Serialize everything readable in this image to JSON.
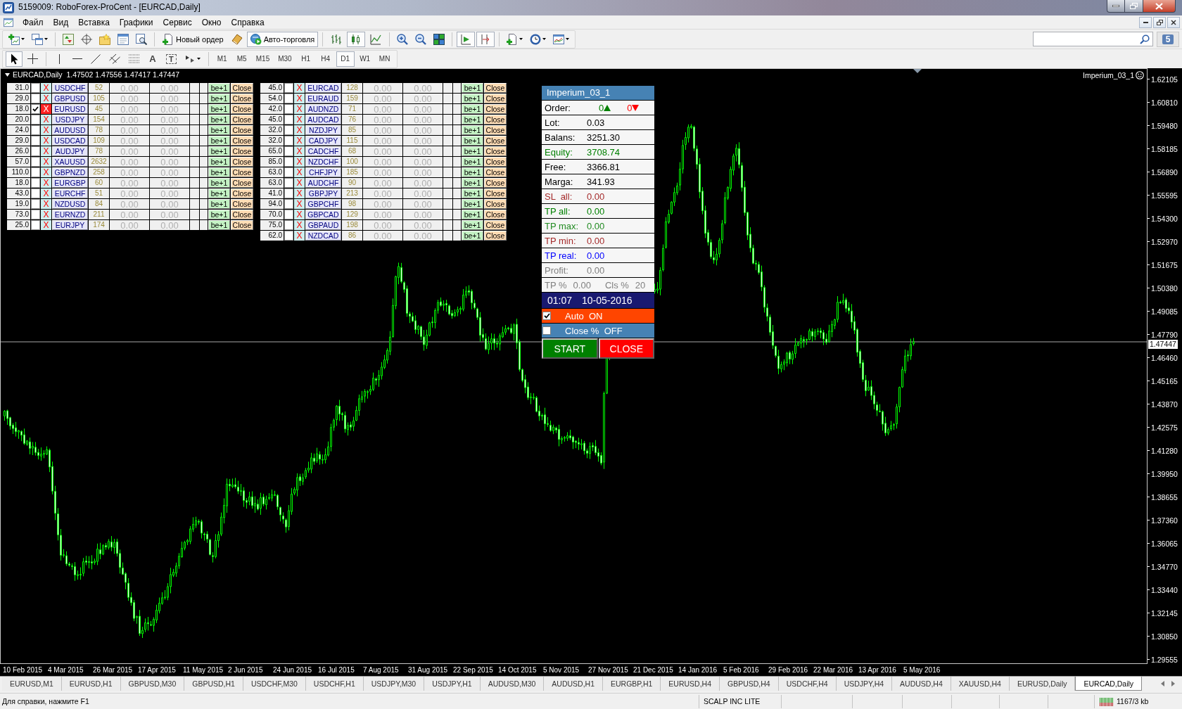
{
  "window": {
    "title": "5159009: RoboForex-ProCent - [EURCAD,Daily]"
  },
  "menu": [
    "Файл",
    "Вид",
    "Вставка",
    "Графики",
    "Сервис",
    "Окно",
    "Справка"
  ],
  "toolbar": {
    "new_order": "Новый ордер",
    "auto_trading": {
      "label": "Авто-торговля",
      "on": true
    },
    "chart_types": [
      {
        "kind": "bars",
        "selected": false
      },
      {
        "kind": "candles",
        "selected": true
      },
      {
        "kind": "line",
        "selected": false
      }
    ],
    "auto_scroll": {
      "on": true
    },
    "chart_shift": {
      "on": true
    },
    "messages_count": "5"
  },
  "drawing_tools": [
    {
      "kind": "cursor",
      "selected": true
    },
    {
      "kind": "crosshair",
      "selected": false
    },
    {
      "kind": "vertical_line",
      "selected": false
    },
    {
      "kind": "horizontal_line",
      "selected": false
    },
    {
      "kind": "trend_line",
      "selected": false
    },
    {
      "kind": "channel",
      "selected": false
    },
    {
      "kind": "fibonacci",
      "selected": false
    },
    {
      "kind": "text",
      "label": "A",
      "selected": false
    },
    {
      "kind": "text_label",
      "label": "T",
      "selected": false
    },
    {
      "kind": "arrows",
      "selected": false
    }
  ],
  "timeframes": [
    {
      "label": "M1",
      "selected": false
    },
    {
      "label": "M5",
      "selected": false
    },
    {
      "label": "M15",
      "selected": false
    },
    {
      "label": "M30",
      "selected": false
    },
    {
      "label": "H1",
      "selected": false
    },
    {
      "label": "H4",
      "selected": false
    },
    {
      "label": "D1",
      "selected": true
    },
    {
      "label": "W1",
      "selected": false
    },
    {
      "label": "MN",
      "selected": false
    }
  ],
  "chart": {
    "header": {
      "symbol": "EURCAD,Daily",
      "prices": [
        "1.47502",
        "1.47556",
        "1.47417",
        "1.47447"
      ]
    },
    "expert": "Imperium_03_1",
    "price_labels": [
      "1.62105",
      "1.60810",
      "1.59480",
      "1.58185",
      "1.56890",
      "1.55595",
      "1.54300",
      "1.52970",
      "1.51675",
      "1.50380",
      "1.49085",
      "1.47790",
      "1.46460",
      "1.45165",
      "1.43870",
      "1.42575",
      "1.41280",
      "1.39950",
      "1.38655",
      "1.37360",
      "1.36065",
      "1.34770",
      "1.33440",
      "1.32145",
      "1.30850",
      "1.29555"
    ],
    "current_price": "1.47447",
    "date_labels": [
      "10 Feb 2015",
      "4 Mar 2015",
      "26 Mar 2015",
      "17 Apr 2015",
      "11 May 2015",
      "2 Jun 2015",
      "24 Jun 2015",
      "16 Jul 2015",
      "7 Aug 2015",
      "31 Aug 2015",
      "22 Sep 2015",
      "14 Oct 2015",
      "5 Nov 2015",
      "27 Nov 2015",
      "21 Dec 2015",
      "14 Jan 2016",
      "5 Feb 2016",
      "29 Feb 2016",
      "22 Mar 2016",
      "13 Apr 2016",
      "5 May 2016"
    ],
    "tables": [
      {
        "rows": [
          {
            "value": "31.0",
            "checked": false,
            "x": "X",
            "x_active": false,
            "symbol": "USDCHF",
            "number": "52",
            "amount_1": "0.00",
            "amount_2": "0.00",
            "be": "be+1",
            "close": "Close"
          },
          {
            "value": "29.0",
            "checked": false,
            "x": "X",
            "x_active": false,
            "symbol": "GBPUSD",
            "number": "105",
            "amount_1": "0.00",
            "amount_2": "0.00",
            "be": "be+1",
            "close": "Close"
          },
          {
            "value": "18.0",
            "checked": true,
            "x": "X",
            "x_active": true,
            "symbol": "EURUSD",
            "number": "45",
            "amount_1": "0.00",
            "amount_2": "0.00",
            "be": "be+1",
            "close": "Close"
          },
          {
            "value": "20.0",
            "checked": false,
            "x": "X",
            "x_active": false,
            "symbol": "USDJPY",
            "number": "154",
            "amount_1": "0.00",
            "amount_2": "0.00",
            "be": "be+1",
            "close": "Close"
          },
          {
            "value": "24.0",
            "checked": false,
            "x": "X",
            "x_active": false,
            "symbol": "AUDUSD",
            "number": "78",
            "amount_1": "0.00",
            "amount_2": "0.00",
            "be": "be+1",
            "close": "Close"
          },
          {
            "value": "29.0",
            "checked": false,
            "x": "X",
            "x_active": false,
            "symbol": "USDCAD",
            "number": "109",
            "amount_1": "0.00",
            "amount_2": "0.00",
            "be": "be+1",
            "close": "Close"
          },
          {
            "value": "26.0",
            "checked": false,
            "x": "X",
            "x_active": false,
            "symbol": "AUDJPY",
            "number": "78",
            "amount_1": "0.00",
            "amount_2": "0.00",
            "be": "be+1",
            "close": "Close"
          },
          {
            "value": "57.0",
            "checked": false,
            "x": "X",
            "x_active": false,
            "symbol": "XAUUSD",
            "number": "2632",
            "amount_1": "0.00",
            "amount_2": "0.00",
            "be": "be+1",
            "close": "Close"
          },
          {
            "value": "110.0",
            "checked": false,
            "x": "X",
            "x_active": false,
            "symbol": "GBPNZD",
            "number": "258",
            "amount_1": "0.00",
            "amount_2": "0.00",
            "be": "be+1",
            "close": "Close"
          },
          {
            "value": "18.0",
            "checked": false,
            "x": "X",
            "x_active": false,
            "symbol": "EURGBP",
            "number": "60",
            "amount_1": "0.00",
            "amount_2": "0.00",
            "be": "be+1",
            "close": "Close"
          },
          {
            "value": "43.0",
            "checked": false,
            "x": "X",
            "x_active": false,
            "symbol": "EURCHF",
            "number": "51",
            "amount_1": "0.00",
            "amount_2": "0.00",
            "be": "be+1",
            "close": "Close"
          },
          {
            "value": "19.0",
            "checked": false,
            "x": "X",
            "x_active": false,
            "symbol": "NZDUSD",
            "number": "84",
            "amount_1": "0.00",
            "amount_2": "0.00",
            "be": "be+1",
            "close": "Close"
          },
          {
            "value": "73.0",
            "checked": false,
            "x": "X",
            "x_active": false,
            "symbol": "EURNZD",
            "number": "211",
            "amount_1": "0.00",
            "amount_2": "0.00",
            "be": "be+1",
            "close": "Close"
          },
          {
            "value": "25.0",
            "checked": false,
            "x": "X",
            "x_active": false,
            "symbol": "EURJPY",
            "number": "174",
            "amount_1": "0.00",
            "amount_2": "0.00",
            "be": "be+1",
            "close": "Close"
          }
        ]
      },
      {
        "rows": [
          {
            "value": "45.0",
            "checked": false,
            "x": "X",
            "x_active": false,
            "symbol": "EURCAD",
            "number": "128",
            "amount_1": "0.00",
            "amount_2": "0.00",
            "be": "be+1",
            "close": "Close"
          },
          {
            "value": "54.0",
            "checked": false,
            "x": "X",
            "x_active": false,
            "symbol": "EURAUD",
            "number": "159",
            "amount_1": "0.00",
            "amount_2": "0.00",
            "be": "be+1",
            "close": "Close"
          },
          {
            "value": "42.0",
            "checked": false,
            "x": "X",
            "x_active": false,
            "symbol": "AUDNZD",
            "number": "71",
            "amount_1": "0.00",
            "amount_2": "0.00",
            "be": "be+1",
            "close": "Close"
          },
          {
            "value": "45.0",
            "checked": false,
            "x": "X",
            "x_active": false,
            "symbol": "AUDCAD",
            "number": "76",
            "amount_1": "0.00",
            "amount_2": "0.00",
            "be": "be+1",
            "close": "Close"
          },
          {
            "value": "32.0",
            "checked": false,
            "x": "X",
            "x_active": false,
            "symbol": "NZDJPY",
            "number": "85",
            "amount_1": "0.00",
            "amount_2": "0.00",
            "be": "be+1",
            "close": "Close"
          },
          {
            "value": "32.0",
            "checked": false,
            "x": "X",
            "x_active": false,
            "symbol": "CADJPY",
            "number": "115",
            "amount_1": "0.00",
            "amount_2": "0.00",
            "be": "be+1",
            "close": "Close"
          },
          {
            "value": "65.0",
            "checked": false,
            "x": "X",
            "x_active": false,
            "symbol": "CADCHF",
            "number": "68",
            "amount_1": "0.00",
            "amount_2": "0.00",
            "be": "be+1",
            "close": "Close"
          },
          {
            "value": "85.0",
            "checked": false,
            "x": "X",
            "x_active": false,
            "symbol": "NZDCHF",
            "number": "100",
            "amount_1": "0.00",
            "amount_2": "0.00",
            "be": "be+1",
            "close": "Close"
          },
          {
            "value": "63.0",
            "checked": false,
            "x": "X",
            "x_active": false,
            "symbol": "CHFJPY",
            "number": "185",
            "amount_1": "0.00",
            "amount_2": "0.00",
            "be": "be+1",
            "close": "Close"
          },
          {
            "value": "63.0",
            "checked": false,
            "x": "X",
            "x_active": false,
            "symbol": "AUDCHF",
            "number": "90",
            "amount_1": "0.00",
            "amount_2": "0.00",
            "be": "be+1",
            "close": "Close"
          },
          {
            "value": "41.0",
            "checked": false,
            "x": "X",
            "x_active": false,
            "symbol": "GBPJPY",
            "number": "213",
            "amount_1": "0.00",
            "amount_2": "0.00",
            "be": "be+1",
            "close": "Close"
          },
          {
            "value": "94.0",
            "checked": false,
            "x": "X",
            "x_active": false,
            "symbol": "GBPCHF",
            "number": "98",
            "amount_1": "0.00",
            "amount_2": "0.00",
            "be": "be+1",
            "close": "Close"
          },
          {
            "value": "70.0",
            "checked": false,
            "x": "X",
            "x_active": false,
            "symbol": "GBPCAD",
            "number": "129",
            "amount_1": "0.00",
            "amount_2": "0.00",
            "be": "be+1",
            "close": "Close"
          },
          {
            "value": "75.0",
            "checked": false,
            "x": "X",
            "x_active": false,
            "symbol": "GBPAUD",
            "number": "198",
            "amount_1": "0.00",
            "amount_2": "0.00",
            "be": "be+1",
            "close": "Close"
          },
          {
            "value": "62.0",
            "checked": false,
            "x": "X",
            "x_active": false,
            "symbol": "NZDCAD",
            "number": "86",
            "amount_1": "0.00",
            "amount_2": "0.00",
            "be": "be+1",
            "close": "Close"
          }
        ]
      }
    ],
    "panel": {
      "title": "Imperium_03_1",
      "order": {
        "label": "Order:",
        "buy": "0",
        "sell": "0"
      },
      "rows": [
        {
          "label": "Lot:",
          "value": "0.03",
          "color": "#000000"
        },
        {
          "label": "Balans:",
          "value": "3251.30",
          "color": "#000000"
        },
        {
          "label": "Equity:",
          "value": "3708.74",
          "color": "#008000"
        },
        {
          "label": "Free:",
          "value": "3366.81",
          "color": "#000000"
        },
        {
          "label": "Marga:",
          "value": "341.93",
          "color": "#000000"
        },
        {
          "label": "SL  all:",
          "value": "0.00",
          "color": "#a52a2a"
        },
        {
          "label": "TP all:",
          "value": "0.00",
          "color": "#008000"
        },
        {
          "label": "TP max:",
          "value": "0.00",
          "color": "#228b22"
        },
        {
          "label": "TP min:",
          "value": "0.00",
          "color": "#a52a2a"
        },
        {
          "label": "TP real:",
          "value": "0.00",
          "color": "#0000ff"
        },
        {
          "label": "Profit:",
          "value": "0.00",
          "color": "#808080"
        }
      ],
      "tp_row": {
        "label": "TP %",
        "value": "0.00",
        "label_2": "Cls %",
        "value_2": "20"
      },
      "clock": {
        "time": "01:07",
        "date": "10-05-2016"
      },
      "toggles": [
        {
          "label": "Auto  ON",
          "checked": true,
          "color": "#ff4500"
        },
        {
          "label": "Close %  OFF",
          "checked": false,
          "color": "#4682b4"
        }
      ],
      "buttons": [
        {
          "label": "START",
          "color": "#008000"
        },
        {
          "label": "CLOSE",
          "color": "#ff0000"
        }
      ]
    }
  },
  "tabs": [
    {
      "label": "EURUSD,M1",
      "selected": false
    },
    {
      "label": "EURUSD,H1",
      "selected": false
    },
    {
      "label": "GBPUSD,M30",
      "selected": false
    },
    {
      "label": "GBPUSD,H1",
      "selected": false
    },
    {
      "label": "USDCHF,M30",
      "selected": false
    },
    {
      "label": "USDCHF,H1",
      "selected": false
    },
    {
      "label": "USDJPY,M30",
      "selected": false
    },
    {
      "label": "USDJPY,H1",
      "selected": false
    },
    {
      "label": "AUDUSD,M30",
      "selected": false
    },
    {
      "label": "AUDUSD,H1",
      "selected": false
    },
    {
      "label": "EURGBP,H1",
      "selected": false
    },
    {
      "label": "EURUSD,H4",
      "selected": false
    },
    {
      "label": "GBPUSD,H4",
      "selected": false
    },
    {
      "label": "USDCHF,H4",
      "selected": false
    },
    {
      "label": "USDJPY,H4",
      "selected": false
    },
    {
      "label": "AUDUSD,H4",
      "selected": false
    },
    {
      "label": "XAUUSD,H4",
      "selected": false
    },
    {
      "label": "EURUSD,Daily",
      "selected": false
    },
    {
      "label": "EURCAD,Daily",
      "selected": true
    }
  ],
  "status_bar": {
    "help": "Для справки, нажмите F1",
    "profile": "SCALP INC LITE",
    "traffic": "1167/3 kb"
  }
}
